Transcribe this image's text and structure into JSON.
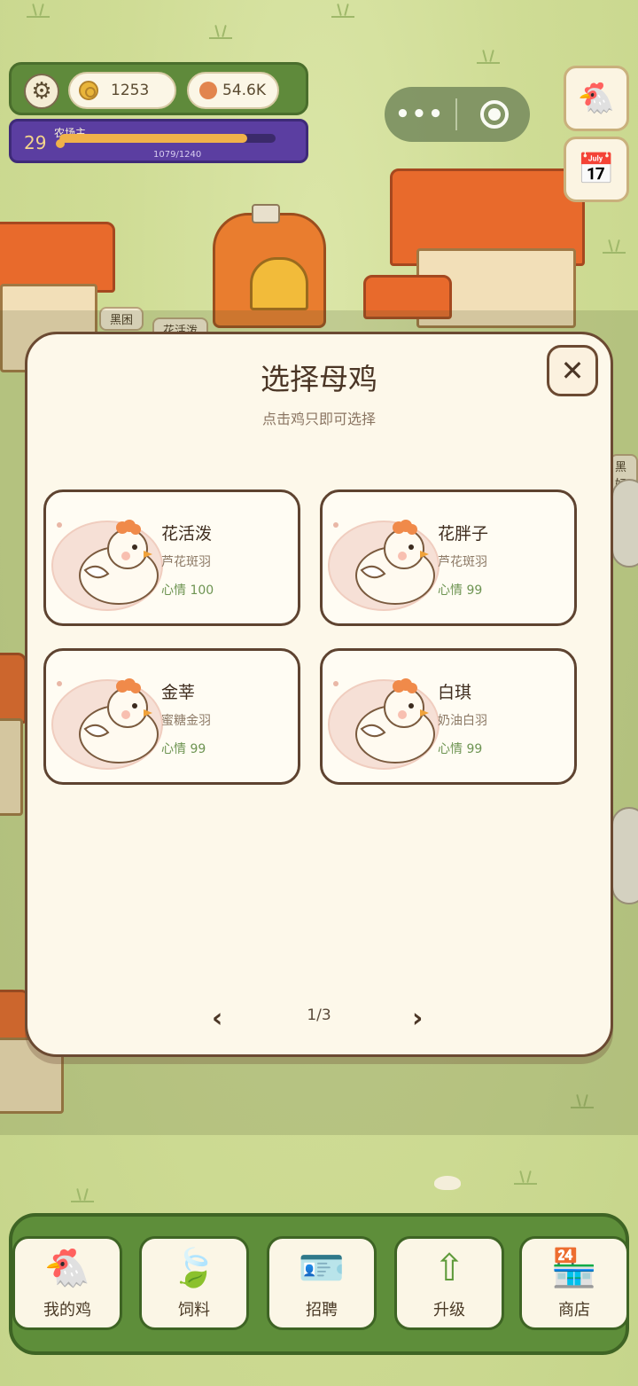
{
  "hud": {
    "coins": "1253",
    "gems": "54.6K",
    "level": "29",
    "title": "农场主",
    "xp": "1079/1240",
    "xp_fraction": 0.87
  },
  "map_tags": {
    "tag1": "黑困",
    "tag2": "花活泼",
    "tag3": "黑好"
  },
  "modal": {
    "title": "选择母鸡",
    "subtitle": "点击鸡只即可选择",
    "close_label": "✕",
    "pager": "1/3",
    "prev": "‹",
    "next": "›",
    "cards": [
      {
        "name": "花活泼",
        "breed": "芦花斑羽",
        "mood": "心情 100"
      },
      {
        "name": "花胖子",
        "breed": "芦花斑羽",
        "mood": "心情 99"
      },
      {
        "name": "金莘",
        "breed": "蜜糖金羽",
        "mood": "心情 99"
      },
      {
        "name": "白琪",
        "breed": "奶油白羽",
        "mood": "心情 99"
      }
    ]
  },
  "tabs": [
    {
      "label": "我的鸡",
      "icon": "chicken-icon"
    },
    {
      "label": "饲料",
      "icon": "leaf-icon"
    },
    {
      "label": "招聘",
      "icon": "badge-icon"
    },
    {
      "label": "升级",
      "icon": "arrow-up-icon"
    },
    {
      "label": "商店",
      "icon": "shop-icon"
    }
  ]
}
